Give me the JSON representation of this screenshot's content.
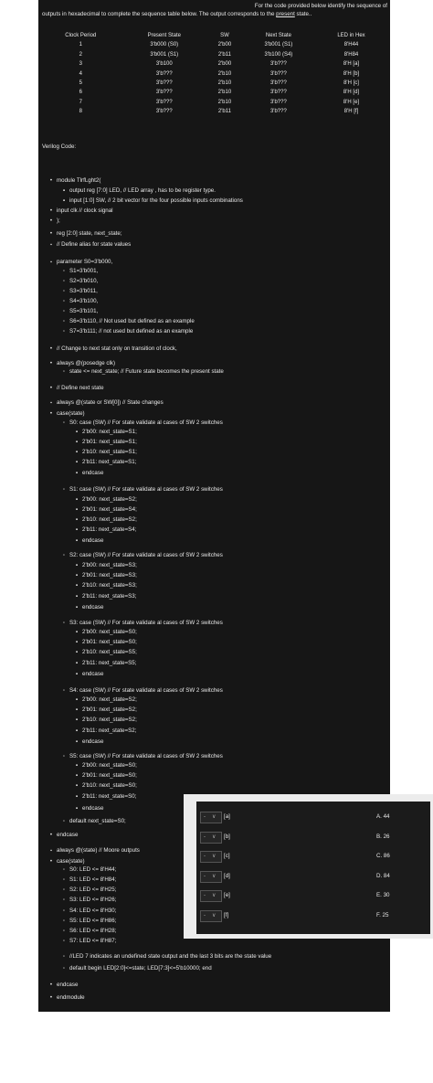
{
  "intro": {
    "line1": "For the  code provided below identify the sequence of",
    "line2_a": "outputs in hexadecimal to complete the sequence table below. The output corresponds to the ",
    "line2_u": "present",
    "line2_b": " state.."
  },
  "table": {
    "headers": [
      "Clock Period",
      "Present State",
      "SW",
      "Next State",
      "LED in Hex"
    ],
    "rows": [
      [
        "1",
        "3'b000 (S0)",
        "2'b00",
        "3'b001 (S1)",
        "8'H44"
      ],
      [
        "2",
        "3'b001 (S1)",
        "2'b11",
        "3'b100 (S4)",
        "8'H84"
      ],
      [
        "3",
        "3'b100",
        "2'b00",
        "3'b???",
        "8'H [a]"
      ],
      [
        "4",
        "3'b???",
        "2'b10",
        "3'b???",
        "8'H [b]"
      ],
      [
        "5",
        "3'b???",
        "2'b10",
        "3'b???",
        "8'H [c]"
      ],
      [
        "6",
        "3'b???",
        "2'b10",
        "3'b???",
        "8'H [d]"
      ],
      [
        "7",
        "3'b???",
        "2'b10",
        "3'b???",
        "8'H [e]"
      ],
      [
        "8",
        "3'b???",
        "2'b11",
        "3'b???",
        "8'H [f]"
      ]
    ]
  },
  "verilog_label": "Verilog Code:",
  "code": [
    "module TlrfLght2(",
    "output reg [7:0] LED, // LED array , has to be register type.",
    "input [1:0] SW, // 2 bit vector for the four possible inputs combinations",
    "input clk // clock signal",
    ");",
    "reg [2:0] state, next_state;",
    "// Define alias for state values",
    "parameter S0=3'b000,",
    "S1=3'b001,",
    "S2=3'b010,",
    "S3=3'b011,",
    "S4=3'b100,",
    "S5=3'b101,",
    "S6=3'b110, // Not used but defined as an example",
    "S7=3'b111; // not used but defined as an example",
    "// Change to next stat only on transition of clock,",
    "always @(posedge clk)",
    "state <= next_state; // Future state becomes the present state",
    "// Define next state",
    "always @(state or SW[0]) // State changes",
    "case(state)",
    "S0: case (SW) // For state validate al cases of SW 2 switches",
    "2'b00: next_state=S1;",
    "2'b01: next_state=S1;",
    "2'b10: next_state=S1;",
    "2'b11: next_state=S1;",
    "endcase",
    "S1: case (SW) // For state validate al cases of SW 2 switches",
    "2'b00: next_state=S2;",
    "2'b01: next_state=S4;",
    "2'b10: next_state=S2;",
    "2'b11: next_state=S4;",
    "endcase",
    "S2: case (SW) // For state validate al cases of SW 2 switches",
    "2'b00: next_state=S3;",
    "2'b01: next_state=S3;",
    "2'b10: next_state=S3;",
    "2'b11: next_state=S3;",
    "endcase",
    "S3: case (SW) // For state validate al cases of SW 2 switches",
    "2'b00: next_state=S0;",
    "2'b01: next_state=S0;",
    "2'b10: next_state=S5;",
    "2'b11: next_state=S5;",
    "endcase",
    "S4: case (SW) // For state validate al cases of SW 2 switches",
    "2'b00: next_state=S2;",
    "2'b01: next_state=S2;",
    "2'b10: next_state=S2;",
    "2'b11: next_state=S2;",
    "endcase",
    "S5: case (SW) // For state validate al cases of SW 2 switches",
    "2'b00: next_state=S0;",
    "2'b01: next_state=S0;",
    "2'b10: next_state=S0;",
    "2'b11: next_state=S0;",
    "endcase",
    "default next_state=S0;",
    "endcase",
    "always @(state) // Moore outputs",
    "case(state)",
    "S0: LED <= 8'H44;",
    "S1: LED <= 8'H84;",
    "S2: LED <= 8'H25;",
    "S3: LED <= 8'H26;",
    "S4: LED <= 8'H30;",
    "S5: LED <= 8'H86;",
    "S6: LED <= 8'H28;",
    "S7: LED <= 8'H87;",
    "//LED 7 indicates an undefined state output and the last 3 bits are the state value",
    "default begin LED[2:0]<=state; LED[7:3]<=5'b10000; end",
    "endcase",
    "endmodule"
  ],
  "answer_panel": {
    "select_dash": "-",
    "select_chevron": "∨",
    "rows": [
      {
        "label": "[a]",
        "option": "A. 44"
      },
      {
        "label": "[b]",
        "option": "B. 26"
      },
      {
        "label": "[c]",
        "option": "C. 86"
      },
      {
        "label": "[d]",
        "option": "D. 84"
      },
      {
        "label": "[e]",
        "option": "E. 30"
      },
      {
        "label": "[f]",
        "option": "F. 25"
      }
    ]
  }
}
